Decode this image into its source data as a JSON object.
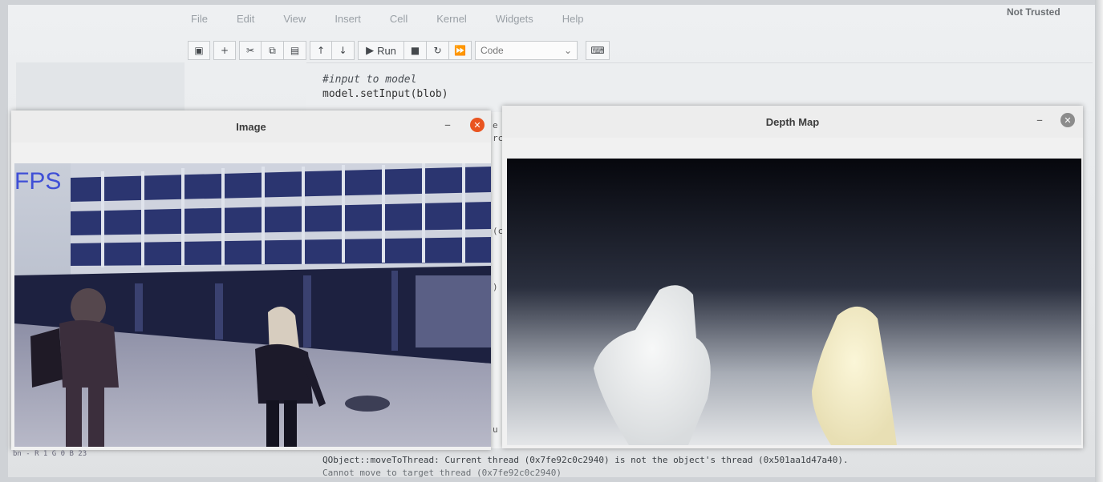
{
  "menubar": {
    "items": [
      "File",
      "Edit",
      "View",
      "Insert",
      "Cell",
      "Kernel",
      "Widgets",
      "Help"
    ],
    "user": "Not Trusted"
  },
  "toolbar": {
    "run_label": "Run",
    "cell_type": "Code"
  },
  "code": {
    "comment": "#input to model",
    "line": "model.setInput(blob)"
  },
  "windows": {
    "image": {
      "title": "Image",
      "overlay_text": "FPS",
      "status": "bn - R 1 G 0 B 23"
    },
    "depth": {
      "title": "Depth Map"
    }
  },
  "output": {
    "line1": "QObject::moveToThread: Current thread (0x7fe92c0c2940) is not the object's thread (0x501aa1d47a40).",
    "line2": "Cannot move to target thread (0x7fe92c0c2940)"
  },
  "colors": {
    "close_red": "#e95420",
    "close_grey": "#8c8c8c",
    "fps_blue": "#3f4fd6"
  }
}
